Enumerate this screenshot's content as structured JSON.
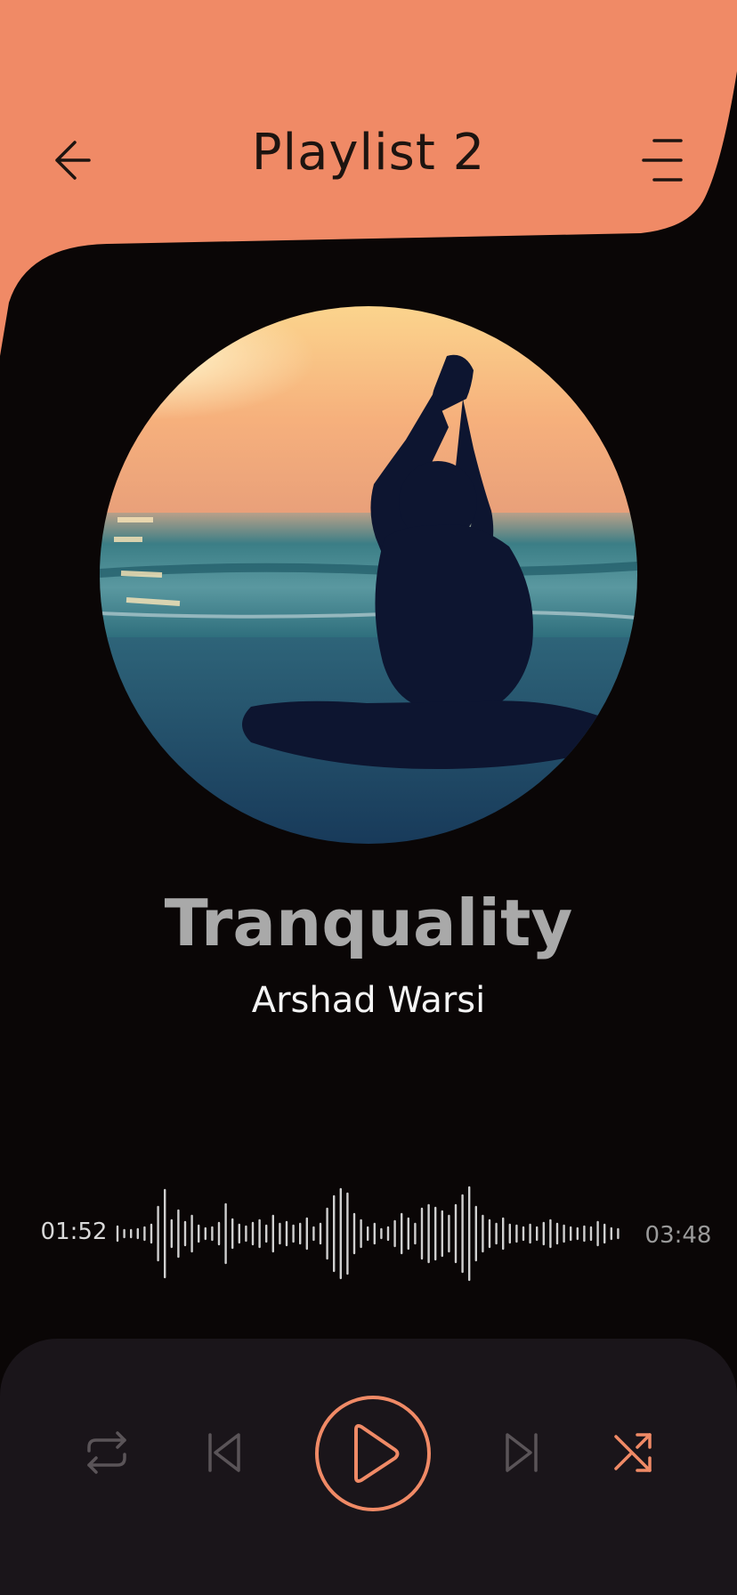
{
  "header": {
    "title": "Playlist 2",
    "back_icon": "arrow-left-icon",
    "menu_icon": "menu-lines-icon",
    "color": "#f08a66"
  },
  "now_playing": {
    "title": "Tranquality",
    "artist": "Arshad Warsi",
    "album_art": "yoga-silhouette-sunset-beach"
  },
  "progress": {
    "elapsed": "01:52",
    "total": "03:48"
  },
  "controls": {
    "repeat_icon": "repeat-icon",
    "previous_icon": "skip-previous-icon",
    "play_icon": "play-icon",
    "next_icon": "skip-next-icon",
    "shuffle_icon": "shuffle-icon",
    "accent_color": "#f08a66",
    "inactive_color": "#5a5458"
  }
}
